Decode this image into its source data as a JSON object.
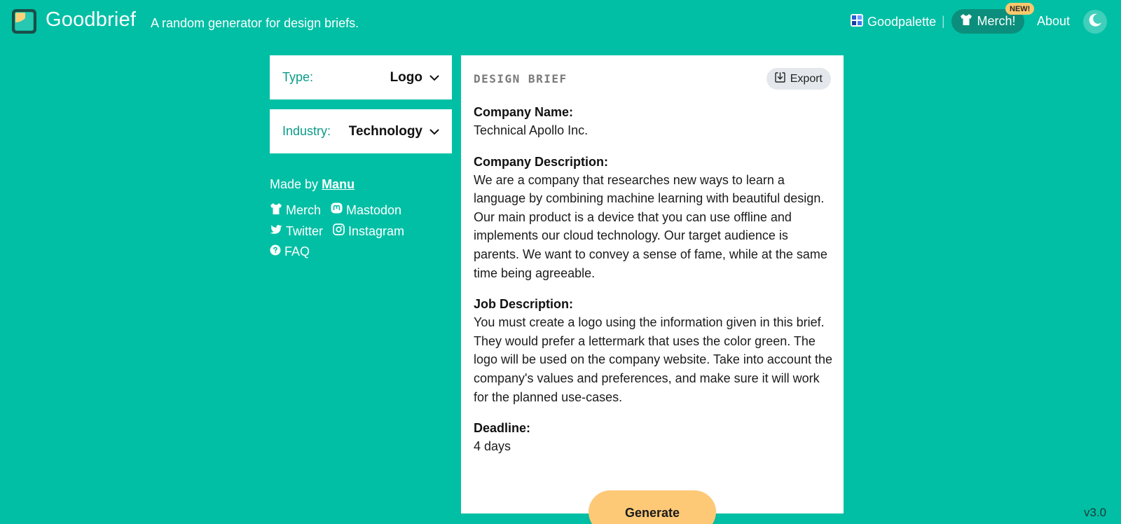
{
  "header": {
    "brand": "Goodbrief",
    "tagline": "A random generator for design briefs.",
    "nav": {
      "goodpalette": "Goodpalette",
      "separator": "|",
      "merch": "Merch!",
      "merch_badge": "NEW!",
      "about": "About"
    }
  },
  "filters": {
    "type": {
      "label": "Type:",
      "value": "Logo"
    },
    "industry": {
      "label": "Industry:",
      "value": "Technology"
    }
  },
  "credits": {
    "made_by_prefix": "Made by",
    "author": "Manu",
    "links": {
      "merch": "Merch",
      "mastodon": "Mastodon",
      "twitter": "Twitter",
      "instagram": "Instagram",
      "faq": "FAQ"
    }
  },
  "brief": {
    "heading": "DESIGN BRIEF",
    "export_label": "Export",
    "sections": [
      {
        "title": "Company Name:",
        "text": "Technical Apollo Inc."
      },
      {
        "title": "Company Description:",
        "text": "We are a company that researches new ways to learn a language by combining machine learning with beautiful design. Our main product is a device that you can use offline and implements our cloud technology. Our target audience is parents. We want to convey a sense of fame, while at the same time being agreeable."
      },
      {
        "title": "Job Description:",
        "text": "You must create a logo using the information given in this brief. They would prefer a lettermark that uses the color green. The logo will be used on the company website. Take into account the company's values and preferences, and make sure it will work for the planned use-cases."
      },
      {
        "title": "Deadline:",
        "text": "4 days"
      }
    ]
  },
  "actions": {
    "generate_label": "Generate"
  },
  "footer": {
    "version": "v3.0"
  },
  "colors": {
    "background": "#00bfa5",
    "accent_text": "#0a9b88",
    "merch_pill": "#0b8f7c",
    "badge": "#fbc96d",
    "generate_button": "#fdc977"
  },
  "icons": {
    "logo": "goodbrief-logo-icon",
    "goodpalette": "palette-icon",
    "merch": "tshirt-icon",
    "theme": "moon-icon",
    "chevron": "chevron-down-icon",
    "export": "download-icon",
    "mastodon": "mastodon-icon",
    "twitter": "twitter-icon",
    "instagram": "instagram-icon",
    "faq": "question-circle-icon"
  }
}
